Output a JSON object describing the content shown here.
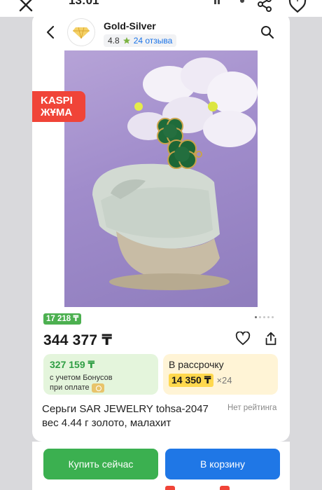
{
  "topbar": {
    "time": "13:01",
    "close_icon": "close-icon",
    "share_icon": "share-icon",
    "heart_icon": "heart-icon"
  },
  "shop": {
    "name": "Gold-Silver",
    "logo_text": "GOLD-SILVER",
    "rating": "4.8",
    "reviews": "24 отзыва"
  },
  "badge": {
    "line1": "KASPI",
    "line2": "ЖҰМА"
  },
  "carousel": {
    "total": 5,
    "active": 0
  },
  "product": {
    "bonus_tag": "17 218 ₸",
    "price": "344 377 ₸",
    "bonus_box": {
      "value": "327 159 ₸",
      "line1": "с учетом Бонусов",
      "line2": "при оплате"
    },
    "credit_box": {
      "label": "В рассрочку",
      "amount": "14 350 ₸",
      "multiplier": "×24"
    },
    "title_line1": "Серьги SAR JEWELRY tohsa-2047",
    "title_line2": "вес 4.44 г золото, малахит",
    "rating_text": "Нет рейтинга"
  },
  "actions": {
    "buy_label": "Купить сейчас",
    "cart_label": "В корзину"
  },
  "colors": {
    "green": "#3bb050",
    "blue": "#1f77e6",
    "badge_red": "#f04438",
    "bonus_bg": "#e4f5dc",
    "credit_bg": "#fff4d6",
    "credit_highlight": "#ffd84d"
  }
}
